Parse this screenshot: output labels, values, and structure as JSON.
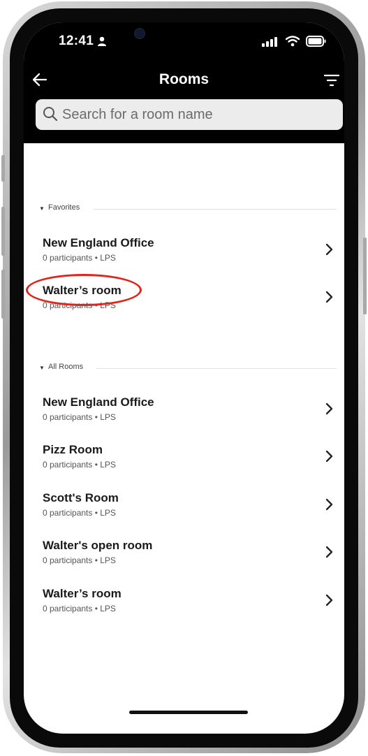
{
  "status_bar": {
    "time": "12:41"
  },
  "nav": {
    "title": "Rooms"
  },
  "search": {
    "placeholder": "Search for a room name"
  },
  "sections": {
    "favorites": {
      "label": "Favorites",
      "rooms": [
        {
          "name": "New England Office",
          "meta": "0 participants • LPS"
        },
        {
          "name": "Walter’s room",
          "meta": "0 participants • LPS"
        }
      ]
    },
    "all_rooms": {
      "label": "All Rooms",
      "rooms": [
        {
          "name": "New England Office",
          "meta": "0 participants • LPS"
        },
        {
          "name": "Pizz Room",
          "meta": "0 participants • LPS"
        },
        {
          "name": "Scott's Room",
          "meta": "0 participants • LPS"
        },
        {
          "name": "Walter's open room",
          "meta": "0 participants • LPS"
        },
        {
          "name": "Walter’s room",
          "meta": "0 participants • LPS"
        }
      ]
    }
  },
  "colors": {
    "header_bg": "#000000",
    "highlight": "#e0261b",
    "search_bg": "#ececec"
  }
}
